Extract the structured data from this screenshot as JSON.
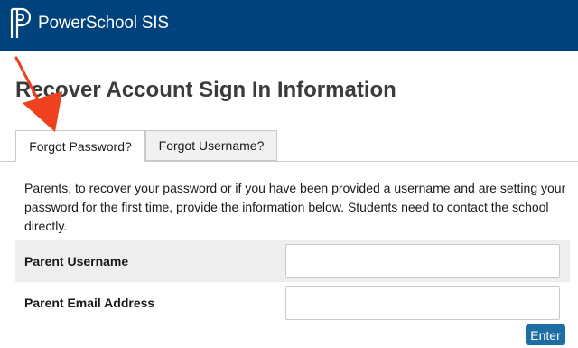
{
  "header": {
    "app_title": "PowerSchool SIS",
    "logo_icon": "powerschool-logo-icon",
    "bar_color": "#00427c"
  },
  "page": {
    "title": "Recover Account Sign In Information"
  },
  "tabs": [
    {
      "label": "Forgot Password?",
      "active": true
    },
    {
      "label": "Forgot Username?",
      "active": false
    }
  ],
  "form": {
    "instructions": "Parents, to recover your password or if you have been provided a username and are setting your password for the first time, provide the information below. Students need to contact the school directly.",
    "fields": [
      {
        "label": "Parent Username",
        "value": "",
        "placeholder": ""
      },
      {
        "label": "Parent Email Address",
        "value": "",
        "placeholder": ""
      }
    ],
    "submit_label": "Enter",
    "submit_color": "#1c6ea4"
  },
  "annotation": {
    "icon": "red-arrow-icon",
    "color": "#f0411f"
  }
}
